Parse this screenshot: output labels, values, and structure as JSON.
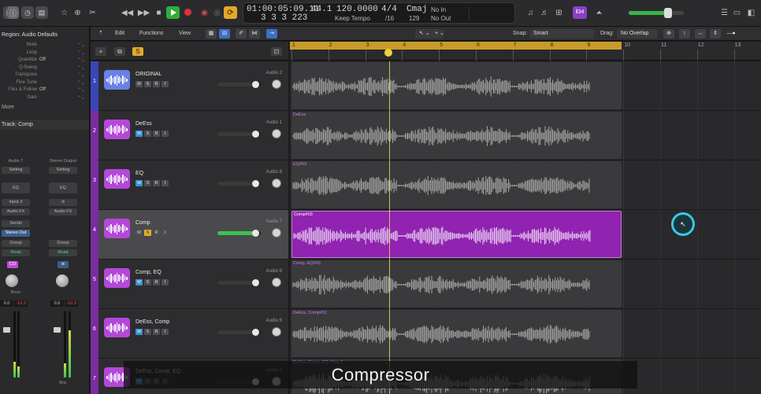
{
  "lcd": {
    "smpte": "01:00:05:09.11",
    "bars": "3 3 3 223",
    "sample_rate": "44.1",
    "tempo": "120.0000",
    "tempo_mode": "Keep Tempo",
    "signature": "4/4",
    "division": "/16",
    "key": "Cmaj",
    "key_sub": "129",
    "midi_in": "No In",
    "midi_out": "No Out"
  },
  "mixer_badge": "⫴34",
  "master_volume_fraction": 0.72,
  "inspector": {
    "region_header": "Region: Audio Defaults",
    "params": [
      {
        "label": "Mute",
        "value": ""
      },
      {
        "label": "Loop",
        "value": ""
      },
      {
        "label": "Quantize",
        "value": "Off"
      },
      {
        "label": "Q-Swing",
        "value": ""
      },
      {
        "label": "Transpose",
        "value": ""
      },
      {
        "label": "Fine Tune",
        "value": ""
      },
      {
        "label": "Flex & Follow",
        "value": "Off"
      },
      {
        "label": "Gain",
        "value": ""
      }
    ],
    "more_label": "More",
    "track_header": "Track: Comp",
    "strip_left": {
      "name": "Audio 7",
      "setting": "Setting",
      "eq": "EQ",
      "input": "Input 3",
      "fx": "Audio FX",
      "sends": "Sends",
      "output": "Stereo Out",
      "group": "Group",
      "automation": "Read",
      "plugin": "CO",
      "bounce": "Bnce",
      "db_left": "0.0",
      "db_right": "-10.3",
      "m": "M",
      "s": "S"
    },
    "strip_right": {
      "name": "Stereo Output",
      "setting": "Setting",
      "eq": "EQ",
      "fx": "Audio FX",
      "group": "Group",
      "automation": "Read",
      "bounce": "Bnc",
      "db_left": "0.0",
      "db_right": "-10.3",
      "m": "M",
      "s": "S"
    }
  },
  "toolbar": {
    "edit": "Edit",
    "functions": "Functions",
    "view": "View",
    "snap_label": "Snap:",
    "snap_value": "Smart",
    "drag_label": "Drag:",
    "drag_value": "No Overlap"
  },
  "ruler": {
    "bars": [
      "1",
      "2",
      "3",
      "4",
      "5",
      "6",
      "7",
      "8",
      "9",
      "10",
      "11",
      "12",
      "13"
    ]
  },
  "tracks": [
    {
      "num": "1",
      "name": "ORIGINAL",
      "out": "Audio 2",
      "region": "",
      "color": "blue",
      "fader": 0.87,
      "mute": false,
      "solo": false,
      "selected": false
    },
    {
      "num": "2",
      "name": "DeEss",
      "out": "Audio 1",
      "region": "DeEss",
      "color": "purple",
      "fader": 0.87,
      "mute": true,
      "solo": false,
      "selected": false
    },
    {
      "num": "3",
      "name": "EQ",
      "out": "Audio 8",
      "region": "EQ#03",
      "color": "purple",
      "fader": 0.87,
      "mute": true,
      "solo": false,
      "selected": false
    },
    {
      "num": "4",
      "name": "Comp",
      "out": "Audio 7",
      "region": "Comp#03",
      "color": "purple",
      "fader": 0.87,
      "mute": false,
      "solo": true,
      "selected": true
    },
    {
      "num": "5",
      "name": "Comp, EQ",
      "out": "Audio 8",
      "region": "Comp, EQ#03",
      "color": "purple",
      "fader": 0.87,
      "mute": true,
      "solo": false,
      "selected": false
    },
    {
      "num": "6",
      "name": "DeEss, Comp",
      "out": "Audio 6",
      "region": "DeEss, Comp#01",
      "color": "purple",
      "fader": 0.87,
      "mute": true,
      "solo": false,
      "selected": false
    },
    {
      "num": "7",
      "name": "DeEss, Comp, EQ",
      "out": "Audio 3",
      "region": "DeEss, Comp, EQ: New 1",
      "color": "purple",
      "fader": 0.87,
      "mute": true,
      "solo": false,
      "selected": false
    }
  ],
  "subtitle": "Compressor",
  "colors": {
    "track_purple": "#7b2ca0",
    "track_blue": "#3a45b8",
    "region_selected": "#9023b0",
    "cycle": "#c89c2c",
    "play": "#2fae3c",
    "record": "#e0303a"
  }
}
